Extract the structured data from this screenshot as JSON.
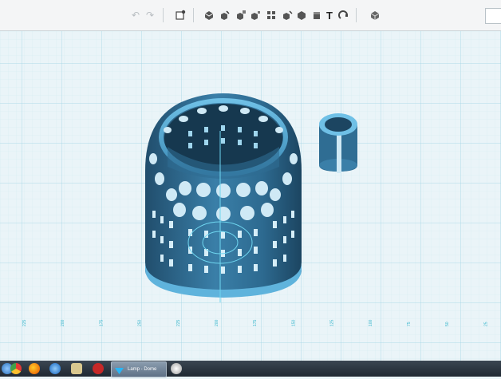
{
  "toolbar": {
    "undo_icon": "undo-icon",
    "redo_icon": "redo-icon",
    "tools": [
      "import-shape-icon",
      "adjust-icon",
      "group-icon",
      "ungroup-icon",
      "align-icon",
      "mirror-icon",
      "duplicate-icon",
      "paint-icon",
      "text-icon",
      "measure-icon",
      "view-cube-icon"
    ],
    "text_tool_label": "T"
  },
  "ruler": {
    "labels": [
      "225",
      "200",
      "175",
      "250",
      "225",
      "200",
      "175",
      "150",
      "125",
      "100",
      "75",
      "50",
      "25"
    ]
  },
  "taskbar": {
    "active_window_label": "Lamp - Dome",
    "apps": [
      "chrome",
      "firefox",
      "network",
      "file-manager",
      "makerbot",
      "app-active",
      "paint"
    ]
  },
  "colors": {
    "grid_bg": "#eaf4f8",
    "grid_major": "#9fd4e4",
    "grid_minor": "#d3ebf2",
    "model_blue": "#3a7fa8",
    "model_highlight": "#6fc0e6"
  }
}
